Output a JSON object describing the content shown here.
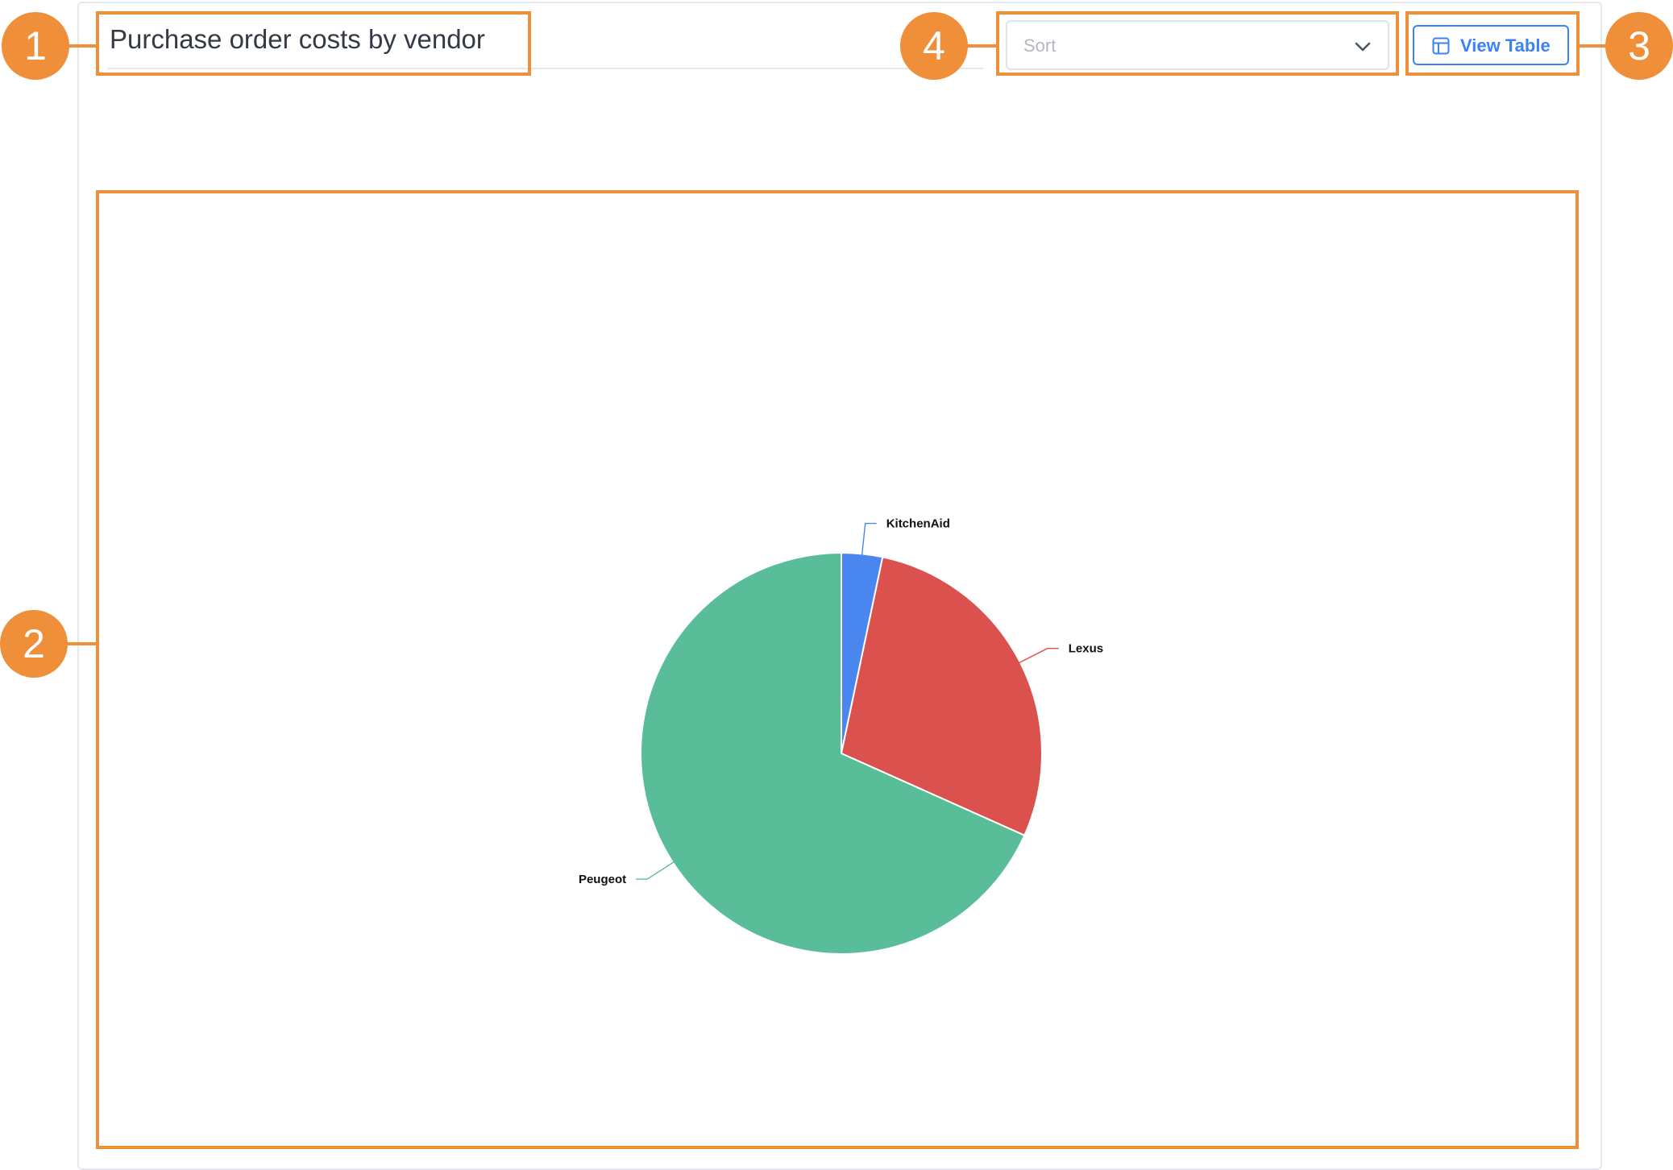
{
  "widget": {
    "title": "Purchase order costs by vendor",
    "sort": {
      "placeholder": "Sort",
      "value": ""
    },
    "view_table_label": "View Table"
  },
  "callouts": [
    "1",
    "2",
    "3",
    "4"
  ],
  "chart_data": {
    "type": "pie",
    "categories": [
      "KitchenAid",
      "Lexus",
      "Peugeot"
    ],
    "values": [
      3.3,
      28.4,
      68.3
    ],
    "colors": [
      "#4a86f0",
      "#db514e",
      "#58bd98"
    ],
    "title": ""
  },
  "colors": {
    "accent": "#3b82f6",
    "annotation": "#ef8f3a"
  },
  "icons": {
    "sort_dropdown": "chevron-down-icon",
    "view_table": "table-icon"
  }
}
